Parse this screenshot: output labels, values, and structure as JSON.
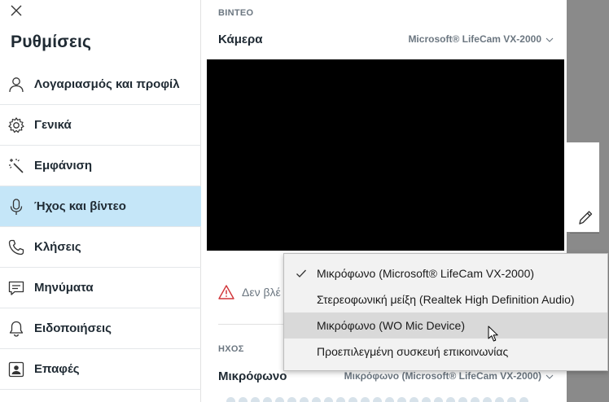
{
  "sidebar": {
    "title": "Ρυθμίσεις",
    "items": [
      {
        "label": "Λογαριασμός και προφίλ",
        "icon": "person-icon"
      },
      {
        "label": "Γενικά",
        "icon": "gear-icon"
      },
      {
        "label": "Εμφάνιση",
        "icon": "magic-wand-icon"
      },
      {
        "label": "Ήχος και βίντεο",
        "icon": "microphone-icon",
        "active": true
      },
      {
        "label": "Κλήσεις",
        "icon": "phone-icon"
      },
      {
        "label": "Μηνύματα",
        "icon": "message-icon"
      },
      {
        "label": "Ειδοποιήσεις",
        "icon": "bell-icon"
      },
      {
        "label": "Επαφές",
        "icon": "contacts-icon"
      }
    ]
  },
  "video": {
    "section_label": "ΒΙΝΤΕΟ",
    "camera_label": "Κάμερα",
    "camera_value": "Microsoft® LifeCam VX-2000",
    "warning_text": "Δεν βλέ"
  },
  "audio": {
    "section_label": "ΗΧΟΣ",
    "mic_label": "Μικρόφωνο",
    "mic_value": "Μικρόφωνο (Microsoft® LifeCam VX-2000)"
  },
  "mic_menu": {
    "items": [
      {
        "label": "Μικρόφωνο (Microsoft® LifeCam VX-2000)",
        "checked": true
      },
      {
        "label": "Στερεοφωνική μείξη (Realtek High Definition Audio)",
        "checked": false
      },
      {
        "label": "Μικρόφωνο (WO Mic Device)",
        "checked": false,
        "hovered": true
      },
      {
        "label": "Προεπιλεγμένη συσκευή επικοινωνίας",
        "checked": false
      }
    ]
  },
  "colors": {
    "active_nav_bg": "#c5e6f8",
    "preview_bg": "#000000",
    "warning": "#d13438",
    "strip_bg": "#8a8a8a",
    "menu_bg": "#f2f2f2",
    "menu_hover": "#d9d9d9"
  }
}
